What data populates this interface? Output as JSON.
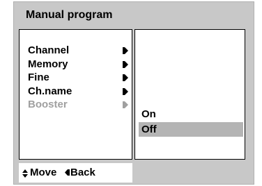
{
  "window": {
    "title": "Manual program"
  },
  "menu": {
    "items": [
      {
        "label": "Channel",
        "enabled": true,
        "icon": "arrow-right-icon"
      },
      {
        "label": "Memory",
        "enabled": true,
        "icon": "arrow-right-icon"
      },
      {
        "label": "Fine",
        "enabled": true,
        "icon": "arrow-right-icon"
      },
      {
        "label": "Ch.name",
        "enabled": true,
        "icon": "arrow-right-icon"
      },
      {
        "label": "Booster",
        "enabled": false,
        "icon": "arrow-right-icon"
      }
    ]
  },
  "options": {
    "items": [
      {
        "label": "On",
        "selected": false
      },
      {
        "label": "Off",
        "selected": true
      }
    ]
  },
  "footer": {
    "move_label": "Move",
    "move_icon": "up-down-arrows-icon",
    "back_label": "Back",
    "back_icon": "arrow-left-icon"
  },
  "colors": {
    "frame": "#c8c8c8",
    "panel": "#ffffff",
    "text": "#000000",
    "disabled_text": "#a0a0a0",
    "selection": "#b4b4b4"
  }
}
